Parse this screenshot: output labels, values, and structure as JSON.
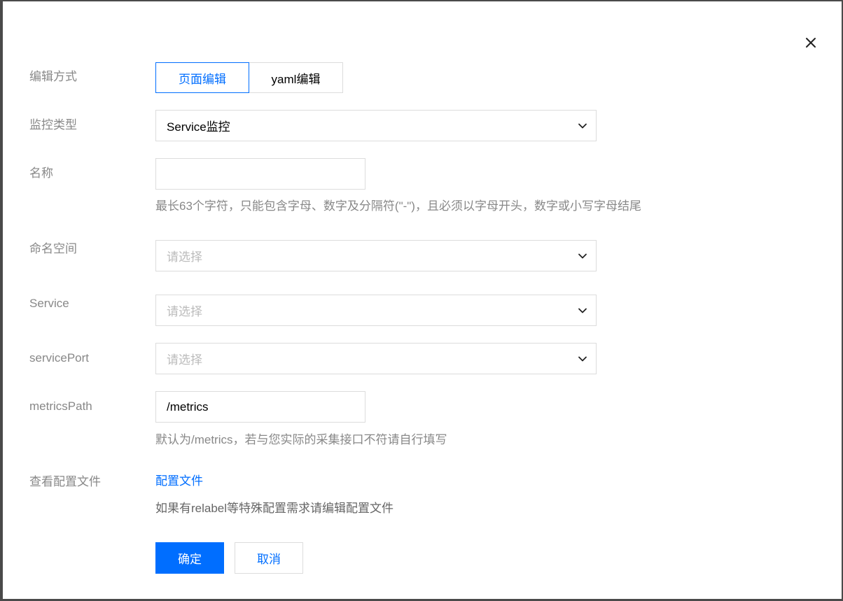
{
  "dialog": {
    "close_icon": "close-icon"
  },
  "fields": {
    "edit_mode": {
      "label": "编辑方式",
      "options": [
        "页面编辑",
        "yaml编辑"
      ],
      "selected": "页面编辑"
    },
    "monitor_type": {
      "label": "监控类型",
      "value": "Service监控"
    },
    "name": {
      "label": "名称",
      "value": "",
      "hint": "最长63个字符，只能包含字母、数字及分隔符(\"-\")，且必须以字母开头，数字或小写字母结尾"
    },
    "namespace": {
      "label": "命名空间",
      "placeholder": "请选择"
    },
    "service": {
      "label": "Service",
      "placeholder": "请选择"
    },
    "service_port": {
      "label": "servicePort",
      "placeholder": "请选择"
    },
    "metrics_path": {
      "label": "metricsPath",
      "value": "/metrics",
      "hint": "默认为/metrics，若与您实际的采集接口不符请自行填写"
    },
    "config_file": {
      "label": "查看配置文件",
      "link": "配置文件",
      "note": "如果有relabel等特殊配置需求请编辑配置文件"
    }
  },
  "actions": {
    "confirm": "确定",
    "cancel": "取消"
  },
  "colors": {
    "accent": "#006eff",
    "label": "#888888",
    "border": "#dcdcdc"
  }
}
